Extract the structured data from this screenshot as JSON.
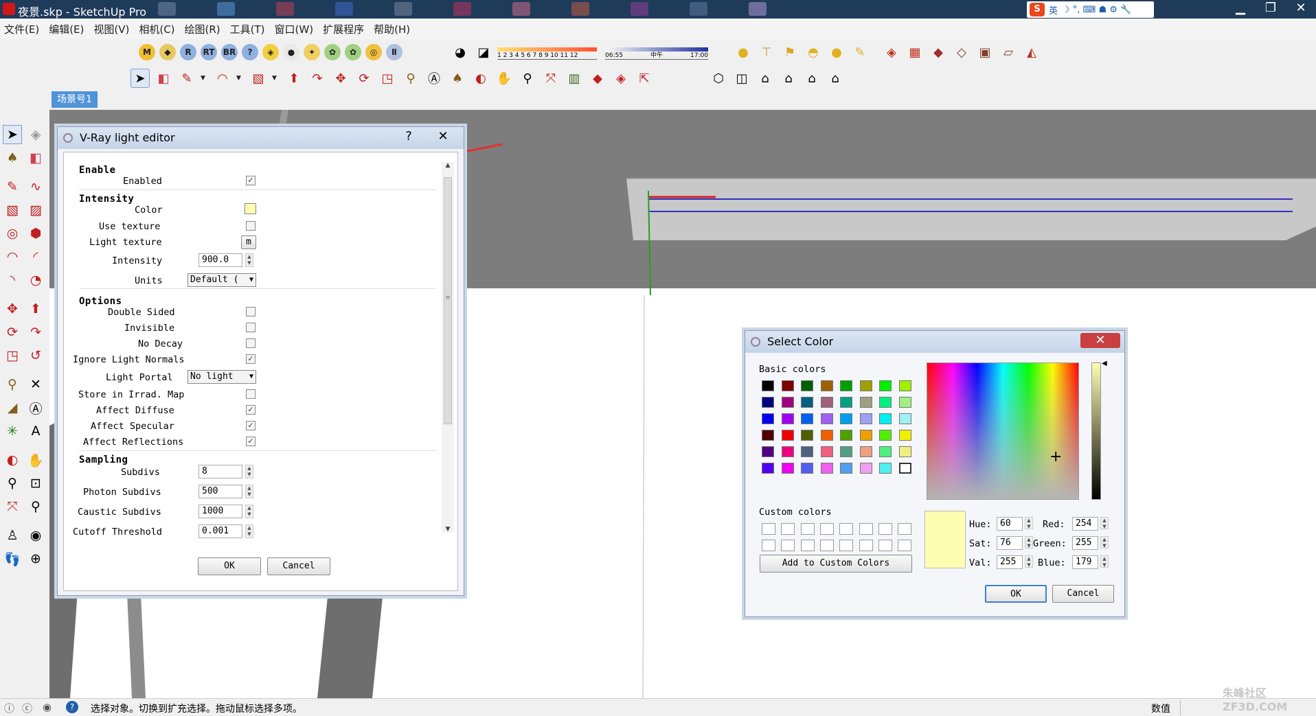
{
  "window": {
    "title": "夜景.skp - SketchUp Pro",
    "minimize": "▁",
    "maximize": "❐",
    "close": "✕"
  },
  "ime": {
    "logo": "S",
    "mode": "英",
    "symbols": "☽ °, ⌨ ☗ ⚙ 🔧"
  },
  "menu": [
    "文件(E)",
    "编辑(E)",
    "视图(V)",
    "相机(C)",
    "绘图(R)",
    "工具(T)",
    "窗口(W)",
    "扩展程序",
    "帮助(H)"
  ],
  "toolbar1": {
    "vray_buttons": [
      "M",
      "◆",
      "R",
      "RT",
      "BR",
      "?",
      "◈",
      "●",
      "✦",
      "✿",
      "✿",
      "◎",
      "Ⅱ"
    ],
    "shadow_months": "1 2 3 4 5 6 7 8 9 10 11 12",
    "shadow_time_start": "06:55",
    "shadow_time_mid": "中午",
    "shadow_time_end": "17:00"
  },
  "scene_tab": "场景号1",
  "vray_editor": {
    "title": "V-Ray light editor",
    "help": "?",
    "close": "✕",
    "sections": {
      "enable": "Enable",
      "intensity": "Intensity",
      "options": "Options",
      "sampling": "Sampling"
    },
    "enabled_label": "Enabled",
    "color_label": "Color",
    "color_value": "#fefeb3",
    "use_texture_label": "Use texture",
    "light_texture_label": "Light texture",
    "light_texture_btn": "m",
    "intensity_label": "Intensity",
    "intensity_value": "900.0",
    "units_label": "Units",
    "units_value": "Default (",
    "double_sided": "Double Sided",
    "invisible": "Invisible",
    "no_decay": "No Decay",
    "ignore_normals": "Ignore Light Normals",
    "light_portal_label": "Light Portal",
    "light_portal_value": "No light",
    "store_irrad": "Store in Irrad. Map",
    "affect_diffuse": "Affect Diffuse",
    "affect_specular": "Affect Specular",
    "affect_reflections": "Affect Reflections",
    "subdivs_label": "Subdivs",
    "subdivs_value": "8",
    "photon_label": "Photon Subdivs",
    "photon_value": "500",
    "caustic_label": "Caustic Subdivs",
    "caustic_value": "1000",
    "cutoff_label": "Cutoff Threshold",
    "cutoff_value": "0.001",
    "ok": "OK",
    "cancel": "Cancel",
    "check": "✓"
  },
  "select_color": {
    "title": "Select Color",
    "close": "✕",
    "basic_label": "Basic colors",
    "custom_label": "Custom colors",
    "add_custom": "Add to Custom Colors",
    "hue_label": "Hue:",
    "hue": "60",
    "sat_label": "Sat:",
    "sat": "76",
    "val_label": "Val:",
    "val": "255",
    "red_label": "Red:",
    "red": "254",
    "green_label": "Green:",
    "green": "255",
    "blue_label": "Blue:",
    "blue": "179",
    "ok": "OK",
    "cancel": "Cancel",
    "preview": "#fefeb3",
    "basic_colors": [
      [
        "#000000",
        "#800000",
        "#006000",
        "#a06000",
        "#00a000",
        "#a0a000",
        "#00f000",
        "#a0f000"
      ],
      [
        "#000080",
        "#a00080",
        "#006080",
        "#a06080",
        "#00a080",
        "#a0a080",
        "#00f080",
        "#a0f080"
      ],
      [
        "#0000f0",
        "#a000f0",
        "#0060f0",
        "#a060f0",
        "#00a0f0",
        "#a0a0f0",
        "#00f0f0",
        "#a0f0f0"
      ],
      [
        "#500000",
        "#f00000",
        "#506000",
        "#f06000",
        "#50a000",
        "#f0a000",
        "#50f000",
        "#f0f000"
      ],
      [
        "#500080",
        "#f00080",
        "#506080",
        "#f06080",
        "#50a080",
        "#f0a080",
        "#50f080",
        "#f0f080"
      ],
      [
        "#5000f0",
        "#f000f0",
        "#5060f0",
        "#f060f0",
        "#50a0f0",
        "#f0a0f0",
        "#50f0f0",
        "#ffffff"
      ]
    ]
  },
  "status": {
    "text": "选择对象。切换到扩充选择。拖动鼠标选择多项。",
    "measure_label": "数值",
    "watermark": "朱峰社区 ZF3D.COM"
  }
}
